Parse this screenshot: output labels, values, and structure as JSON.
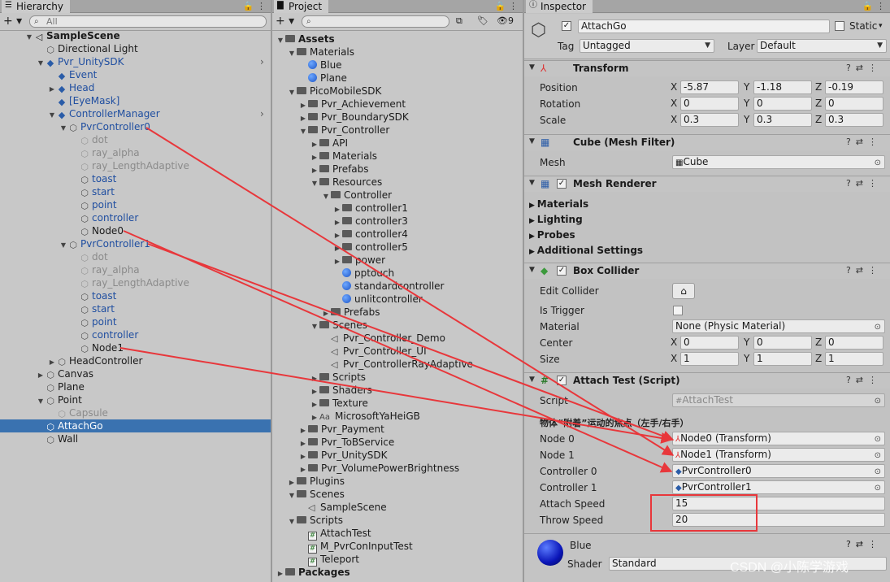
{
  "hierarchy": {
    "tab": "Hierarchy",
    "search_placeholder": "All",
    "items": [
      {
        "label": "SampleScene",
        "indent": 0,
        "arrow": "▼",
        "icon": "unity-scene-icon",
        "bold": true
      },
      {
        "label": "Directional Light",
        "indent": 1,
        "arrow": "",
        "icon": "cube-icon"
      },
      {
        "label": "Pvr_UnitySDK",
        "indent": 1,
        "arrow": "▼",
        "icon": "prefab-cube-icon",
        "blue": true,
        "more": true
      },
      {
        "label": "Event",
        "indent": 2,
        "arrow": "",
        "icon": "prefab-cube-icon",
        "blue": true
      },
      {
        "label": "Head",
        "indent": 2,
        "arrow": "▶",
        "icon": "prefab-cube-icon",
        "blue": true
      },
      {
        "label": "[EyeMask]",
        "indent": 2,
        "arrow": "",
        "icon": "prefab-cube-icon",
        "blue": true
      },
      {
        "label": "ControllerManager",
        "indent": 2,
        "arrow": "▼",
        "icon": "prefab-cube-plus-icon",
        "blue": true,
        "more": true
      },
      {
        "label": "PvrController0",
        "indent": 3,
        "arrow": "▼",
        "icon": "cube-icon",
        "blue": true
      },
      {
        "label": "dot",
        "indent": 4,
        "arrow": "",
        "icon": "cube-icon",
        "grey": true
      },
      {
        "label": "ray_alpha",
        "indent": 4,
        "arrow": "",
        "icon": "cube-icon",
        "grey": true
      },
      {
        "label": "ray_LengthAdaptive",
        "indent": 4,
        "arrow": "",
        "icon": "cube-icon",
        "grey": true
      },
      {
        "label": "toast",
        "indent": 4,
        "arrow": "",
        "icon": "cube-icon",
        "blue": true
      },
      {
        "label": "start",
        "indent": 4,
        "arrow": "",
        "icon": "cube-icon",
        "blue": true
      },
      {
        "label": "point",
        "indent": 4,
        "arrow": "",
        "icon": "cube-icon",
        "blue": true
      },
      {
        "label": "controller",
        "indent": 4,
        "arrow": "",
        "icon": "cube-icon",
        "blue": true
      },
      {
        "label": "Node0",
        "indent": 4,
        "arrow": "",
        "icon": "cube-plus-icon"
      },
      {
        "label": "PvrController1",
        "indent": 3,
        "arrow": "▼",
        "icon": "cube-icon",
        "blue": true
      },
      {
        "label": "dot",
        "indent": 4,
        "arrow": "",
        "icon": "cube-icon",
        "grey": true
      },
      {
        "label": "ray_alpha",
        "indent": 4,
        "arrow": "",
        "icon": "cube-icon",
        "grey": true
      },
      {
        "label": "ray_LengthAdaptive",
        "indent": 4,
        "arrow": "",
        "icon": "cube-icon",
        "grey": true
      },
      {
        "label": "toast",
        "indent": 4,
        "arrow": "",
        "icon": "cube-icon",
        "blue": true
      },
      {
        "label": "start",
        "indent": 4,
        "arrow": "",
        "icon": "cube-icon",
        "blue": true
      },
      {
        "label": "point",
        "indent": 4,
        "arrow": "",
        "icon": "cube-icon",
        "blue": true
      },
      {
        "label": "controller",
        "indent": 4,
        "arrow": "",
        "icon": "cube-icon",
        "blue": true
      },
      {
        "label": "Node1",
        "indent": 4,
        "arrow": "",
        "icon": "cube-plus-icon"
      },
      {
        "label": "HeadController",
        "indent": 2,
        "arrow": "▶",
        "icon": "cube-plus-icon"
      },
      {
        "label": "Canvas",
        "indent": 1,
        "arrow": "▶",
        "icon": "cube-icon"
      },
      {
        "label": "Plane",
        "indent": 1,
        "arrow": "",
        "icon": "cube-icon"
      },
      {
        "label": "Point",
        "indent": 1,
        "arrow": "▼",
        "icon": "cube-icon"
      },
      {
        "label": "Capsule",
        "indent": 2,
        "arrow": "",
        "icon": "cube-icon",
        "grey": true
      },
      {
        "label": "AttachGo",
        "indent": 1,
        "arrow": "",
        "icon": "cube-icon",
        "selected": true
      },
      {
        "label": "Wall",
        "indent": 1,
        "arrow": "",
        "icon": "cube-icon"
      }
    ]
  },
  "project": {
    "tab": "Project",
    "hidden_count": "9",
    "items": [
      {
        "label": "Assets",
        "indent": 0,
        "arrow": "▼",
        "icon": "folder",
        "bold": true
      },
      {
        "label": "Materials",
        "indent": 1,
        "arrow": "▼",
        "icon": "folder"
      },
      {
        "label": "Blue",
        "indent": 2,
        "arrow": "",
        "icon": "material"
      },
      {
        "label": "Plane",
        "indent": 2,
        "arrow": "",
        "icon": "material"
      },
      {
        "label": "PicoMobileSDK",
        "indent": 1,
        "arrow": "▼",
        "icon": "folder"
      },
      {
        "label": "Pvr_Achievement",
        "indent": 2,
        "arrow": "▶",
        "icon": "folder"
      },
      {
        "label": "Pvr_BoundarySDK",
        "indent": 2,
        "arrow": "▶",
        "icon": "folder"
      },
      {
        "label": "Pvr_Controller",
        "indent": 2,
        "arrow": "▼",
        "icon": "folder"
      },
      {
        "label": "API",
        "indent": 3,
        "arrow": "▶",
        "icon": "folder"
      },
      {
        "label": "Materials",
        "indent": 3,
        "arrow": "▶",
        "icon": "folder"
      },
      {
        "label": "Prefabs",
        "indent": 3,
        "arrow": "▶",
        "icon": "folder"
      },
      {
        "label": "Resources",
        "indent": 3,
        "arrow": "▼",
        "icon": "folder"
      },
      {
        "label": "Controller",
        "indent": 4,
        "arrow": "▼",
        "icon": "folder"
      },
      {
        "label": "controller1",
        "indent": 5,
        "arrow": "▶",
        "icon": "folder"
      },
      {
        "label": "controller3",
        "indent": 5,
        "arrow": "▶",
        "icon": "folder"
      },
      {
        "label": "controller4",
        "indent": 5,
        "arrow": "▶",
        "icon": "folder"
      },
      {
        "label": "controller5",
        "indent": 5,
        "arrow": "▶",
        "icon": "folder"
      },
      {
        "label": "power",
        "indent": 5,
        "arrow": "▶",
        "icon": "folder"
      },
      {
        "label": "pptouch",
        "indent": 5,
        "arrow": "",
        "icon": "material"
      },
      {
        "label": "standardcontroller",
        "indent": 5,
        "arrow": "",
        "icon": "material"
      },
      {
        "label": "unlitcontroller",
        "indent": 5,
        "arrow": "",
        "icon": "material"
      },
      {
        "label": "Prefabs",
        "indent": 4,
        "arrow": "▶",
        "icon": "folder"
      },
      {
        "label": "Scenes",
        "indent": 3,
        "arrow": "▼",
        "icon": "folder"
      },
      {
        "label": "Pvr_Controller_Demo",
        "indent": 4,
        "arrow": "",
        "icon": "scene"
      },
      {
        "label": "Pvr_Controller_UI",
        "indent": 4,
        "arrow": "",
        "icon": "scene"
      },
      {
        "label": "Pvr_ControllerRayAdaptive",
        "indent": 4,
        "arrow": "",
        "icon": "scene"
      },
      {
        "label": "Scripts",
        "indent": 3,
        "arrow": "▶",
        "icon": "folder"
      },
      {
        "label": "Shaders",
        "indent": 3,
        "arrow": "▶",
        "icon": "folder"
      },
      {
        "label": "Texture",
        "indent": 3,
        "arrow": "▶",
        "icon": "folder"
      },
      {
        "label": "MicrosoftYaHeiGB",
        "indent": 3,
        "arrow": "▶",
        "icon": "font"
      },
      {
        "label": "Pvr_Payment",
        "indent": 2,
        "arrow": "▶",
        "icon": "folder"
      },
      {
        "label": "Pvr_ToBService",
        "indent": 2,
        "arrow": "▶",
        "icon": "folder"
      },
      {
        "label": "Pvr_UnitySDK",
        "indent": 2,
        "arrow": "▶",
        "icon": "folder"
      },
      {
        "label": "Pvr_VolumePowerBrightness",
        "indent": 2,
        "arrow": "▶",
        "icon": "folder"
      },
      {
        "label": "Plugins",
        "indent": 1,
        "arrow": "▶",
        "icon": "folder"
      },
      {
        "label": "Scenes",
        "indent": 1,
        "arrow": "▼",
        "icon": "folder"
      },
      {
        "label": "SampleScene",
        "indent": 2,
        "arrow": "",
        "icon": "scene"
      },
      {
        "label": "Scripts",
        "indent": 1,
        "arrow": "▼",
        "icon": "folder"
      },
      {
        "label": "AttachTest",
        "indent": 2,
        "arrow": "",
        "icon": "script"
      },
      {
        "label": "M_PvrConInputTest",
        "indent": 2,
        "arrow": "",
        "icon": "script"
      },
      {
        "label": "Teleport",
        "indent": 2,
        "arrow": "",
        "icon": "script"
      },
      {
        "label": "Packages",
        "indent": 0,
        "arrow": "▶",
        "icon": "folder",
        "bold": true
      }
    ]
  },
  "inspector": {
    "tab": "Inspector",
    "object_name": "AttachGo",
    "static_label": "Static",
    "tag_label": "Tag",
    "tag_value": "Untagged",
    "layer_label": "Layer",
    "layer_value": "Default",
    "transform": {
      "title": "Transform",
      "position_label": "Position",
      "position": [
        "-5.87",
        "-1.18",
        "-0.19"
      ],
      "rotation_label": "Rotation",
      "rotation": [
        "0",
        "0",
        "0"
      ],
      "scale_label": "Scale",
      "scale": [
        "0.3",
        "0.3",
        "0.3"
      ]
    },
    "axis": [
      "X",
      "Y",
      "Z"
    ],
    "mesh_filter": {
      "title": "Cube (Mesh Filter)",
      "mesh_label": "Mesh",
      "mesh_value": "Cube"
    },
    "mesh_renderer": {
      "title": "Mesh Renderer",
      "sections": [
        "Materials",
        "Lighting",
        "Probes",
        "Additional Settings"
      ]
    },
    "box_collider": {
      "title": "Box Collider",
      "edit_label": "Edit Collider",
      "trigger_label": "Is Trigger",
      "material_label": "Material",
      "material_value": "None (Physic Material)",
      "center_label": "Center",
      "center": [
        "0",
        "0",
        "0"
      ],
      "size_label": "Size",
      "size": [
        "1",
        "1",
        "1"
      ]
    },
    "attach_test": {
      "title": "Attach Test (Script)",
      "script_label": "Script",
      "script_value": "AttachTest",
      "header": "物体“附着”运动的焦点（左手/右手）",
      "node0_label": "Node 0",
      "node0_value": "Node0 (Transform)",
      "node1_label": "Node 1",
      "node1_value": "Node1 (Transform)",
      "ctrl0_label": "Controller 0",
      "ctrl0_value": "PvrController0",
      "ctrl1_label": "Controller 1",
      "ctrl1_value": "PvrController1",
      "speed_label": "Attach Speed",
      "speed_value": "15",
      "throw_label": "Throw Speed",
      "throw_value": "20"
    },
    "material": {
      "name": "Blue",
      "shader_label": "Shader",
      "shader_value": "Standard"
    }
  },
  "watermark": "CSDN @小陈学游戏",
  "colors": {
    "annotation": "#e8373b",
    "selection": "#3a72b0",
    "prefab_blue": "#1f4ea0"
  }
}
